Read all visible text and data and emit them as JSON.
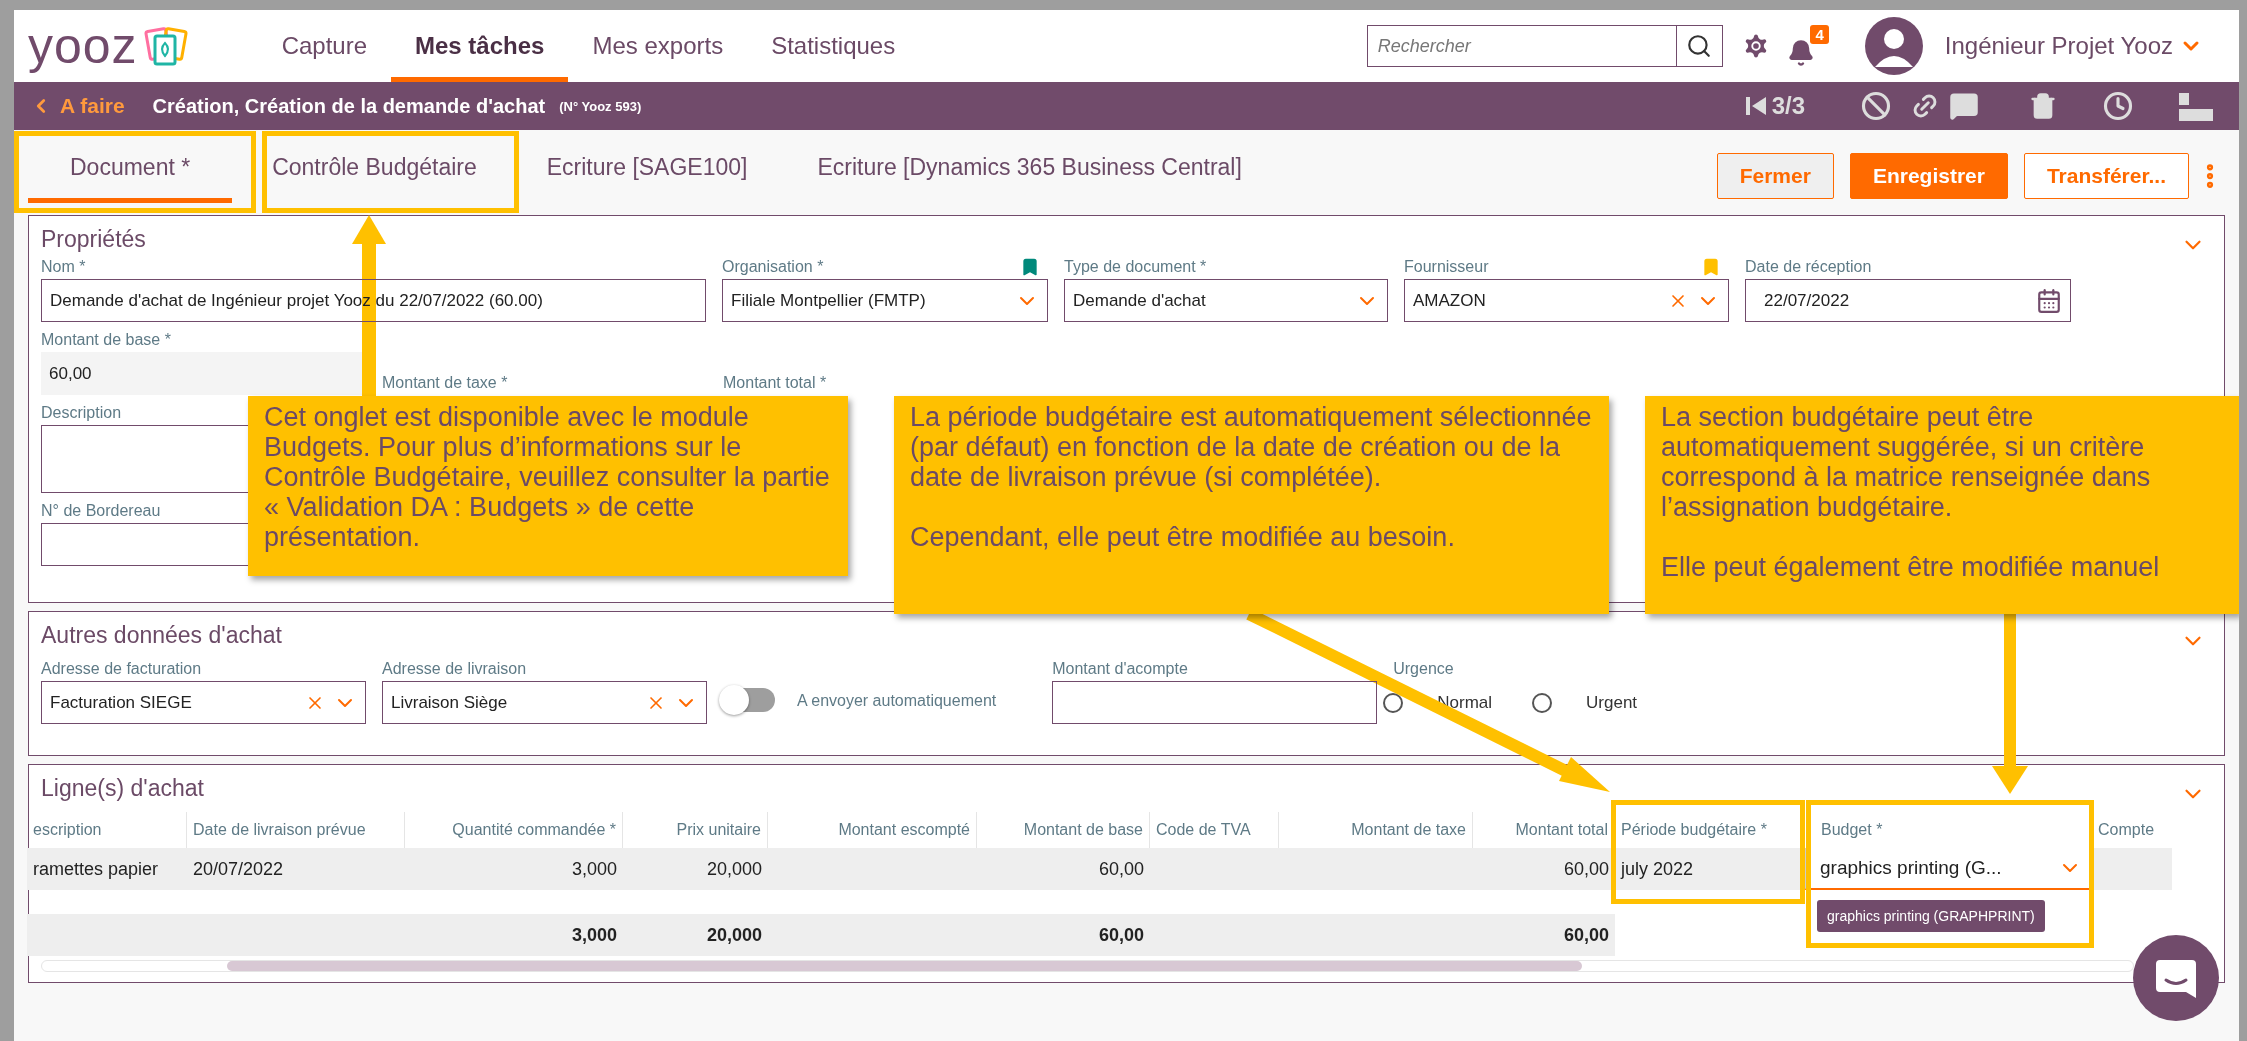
{
  "header": {
    "logo": "yooz",
    "nav": [
      {
        "label": "Capture",
        "selected": false
      },
      {
        "label": "Mes tâches",
        "selected": true
      },
      {
        "label": "Mes exports",
        "selected": false
      },
      {
        "label": "Statistiques",
        "selected": false
      }
    ],
    "search": {
      "placeholder": "Rechercher"
    },
    "notifications": "4",
    "user": "Ingénieur Projet Yooz"
  },
  "breadcrumb": {
    "back": "A faire",
    "title": "Création, Création de la demande d'achat",
    "reference": "(N° Yooz 593)",
    "pager": "3/3"
  },
  "tabs": [
    {
      "label": "Document *",
      "selected": true
    },
    {
      "label": "Contrôle Budgétaire",
      "selected": false
    },
    {
      "label": "Ecriture [SAGE100]",
      "selected": false
    },
    {
      "label": "Ecriture [Dynamics 365 Business Central]",
      "selected": false
    }
  ],
  "actions": [
    {
      "label": "Fermer",
      "kind": "secondary"
    },
    {
      "label": "Enregistrer",
      "kind": "primary"
    },
    {
      "label": "Transférer...",
      "kind": "outline"
    }
  ],
  "properties": {
    "title": "Propriétés",
    "fields": [
      {
        "label": "Nom *",
        "kind": "text",
        "value": "Demande d'achat de Ingénieur projet Yooz du 22/07/2022 (60.00)"
      },
      {
        "label": "Organisation *",
        "kind": "select",
        "value": "Filiale Montpellier (FMTP)",
        "clearable": false,
        "color": "#00897b"
      },
      {
        "label": "Type de document *",
        "kind": "select",
        "value": "Demande d'achat",
        "clearable": false
      },
      {
        "label": "Fournisseur",
        "kind": "select",
        "value": "AMAZON",
        "clearable": true,
        "color": "#ffc000"
      },
      {
        "label": "Date de réception",
        "kind": "date",
        "value": "22/07/2022"
      },
      {
        "label": "Montant de base *",
        "kind": "readonly",
        "value": "60,00"
      },
      {
        "label": "Montant de taxe *",
        "kind": "label"
      },
      {
        "label": "Montant total *",
        "kind": "label"
      },
      {
        "label": "Description",
        "kind": "textarea"
      },
      {
        "label": "N° de Bordereau",
        "kind": "text"
      }
    ]
  },
  "other_purchase_data": {
    "title": "Autres données d'achat",
    "billing": {
      "label": "Adresse de facturation",
      "value": "Facturation SIEGE"
    },
    "delivery": {
      "label": "Adresse de livraison",
      "value": "Livraison Siège"
    },
    "auto_send": {
      "label": "A envoyer automatiquement",
      "on": false
    },
    "deposit": {
      "label": "Montant d'acompte"
    },
    "urgency": {
      "label": "Urgence",
      "options": [
        {
          "label": "Normal",
          "selected": false
        },
        {
          "label": "Urgent",
          "selected": false
        }
      ]
    }
  },
  "purchase_lines": {
    "title": "Ligne(s) d'achat",
    "columns": [
      "escription",
      "Date de livraison prévue",
      "Quantité commandée *",
      "Prix unitaire",
      "Montant escompté",
      "Montant de base",
      "Code de TVA",
      "Montant de taxe",
      "Montant total",
      "Période budgétaire *",
      "Budget *",
      "Compte"
    ],
    "rows": [
      [
        "ramettes papier",
        "20/07/2022",
        "3,000",
        "20,000",
        null,
        "60,00",
        null,
        null,
        "60,00",
        "july 2022",
        "graphics printing (G...",
        null
      ]
    ],
    "totals": {
      "quantity": "3,000",
      "unit_price": "20,000",
      "base_amount": "60,00",
      "total_amount": "60,00"
    },
    "budget_tooltip": "graphics printing (GRAPHPRINT)"
  },
  "callouts": [
    {
      "paragraphs": [
        "Cet onglet est disponible avec le module Budgets. Pour plus d’informations sur le Contrôle Budgétaire, veuillez consulter la partie « Validation DA : Budgets » de cette présentation."
      ]
    },
    {
      "paragraphs": [
        "La période budgétaire est automatiquement sélectionnée (par défaut) en fonction de la date de création ou de la date de livraison prévue (si complétée).",
        "Cependant, elle peut être modifiée au besoin."
      ]
    },
    {
      "paragraphs": [
        "La section budgétaire peut être automatiquement suggérée, si un critère correspond à la matrice renseignée dans l’assignation budgétaire.",
        "Elle peut également être modifiée manuel"
      ]
    }
  ]
}
